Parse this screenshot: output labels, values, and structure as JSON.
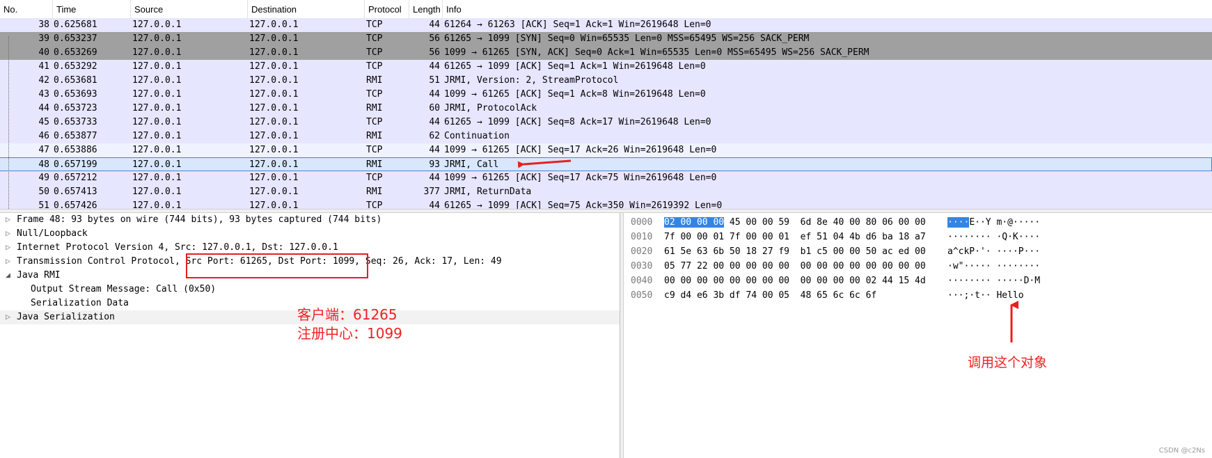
{
  "columns": [
    "No.",
    "Time",
    "Source",
    "Destination",
    "Protocol",
    "Length",
    "Info"
  ],
  "packets": [
    {
      "no": "38",
      "time": "0.625681",
      "src": "127.0.0.1",
      "dst": "127.0.0.1",
      "proto": "TCP",
      "len": "44",
      "info": "61264 → 61263 [ACK] Seq=1 Ack=1 Win=2619648 Len=0"
    },
    {
      "no": "39",
      "time": "0.653237",
      "src": "127.0.0.1",
      "dst": "127.0.0.1",
      "proto": "TCP",
      "len": "56",
      "info": "61265 → 1099 [SYN] Seq=0 Win=65535 Len=0 MSS=65495 WS=256 SACK_PERM"
    },
    {
      "no": "40",
      "time": "0.653269",
      "src": "127.0.0.1",
      "dst": "127.0.0.1",
      "proto": "TCP",
      "len": "56",
      "info": "1099 → 61265 [SYN, ACK] Seq=0 Ack=1 Win=65535 Len=0 MSS=65495 WS=256 SACK_PERM"
    },
    {
      "no": "41",
      "time": "0.653292",
      "src": "127.0.0.1",
      "dst": "127.0.0.1",
      "proto": "TCP",
      "len": "44",
      "info": "61265 → 1099 [ACK] Seq=1 Ack=1 Win=2619648 Len=0"
    },
    {
      "no": "42",
      "time": "0.653681",
      "src": "127.0.0.1",
      "dst": "127.0.0.1",
      "proto": "RMI",
      "len": "51",
      "info": "JRMI, Version: 2, StreamProtocol"
    },
    {
      "no": "43",
      "time": "0.653693",
      "src": "127.0.0.1",
      "dst": "127.0.0.1",
      "proto": "TCP",
      "len": "44",
      "info": "1099 → 61265 [ACK] Seq=1 Ack=8 Win=2619648 Len=0"
    },
    {
      "no": "44",
      "time": "0.653723",
      "src": "127.0.0.1",
      "dst": "127.0.0.1",
      "proto": "RMI",
      "len": "60",
      "info": "JRMI, ProtocolAck"
    },
    {
      "no": "45",
      "time": "0.653733",
      "src": "127.0.0.1",
      "dst": "127.0.0.1",
      "proto": "TCP",
      "len": "44",
      "info": "61265 → 1099 [ACK] Seq=8 Ack=17 Win=2619648 Len=0"
    },
    {
      "no": "46",
      "time": "0.653877",
      "src": "127.0.0.1",
      "dst": "127.0.0.1",
      "proto": "RMI",
      "len": "62",
      "info": "Continuation"
    },
    {
      "no": "47",
      "time": "0.653886",
      "src": "127.0.0.1",
      "dst": "127.0.0.1",
      "proto": "TCP",
      "len": "44",
      "info": "1099 → 61265 [ACK] Seq=17 Ack=26 Win=2619648 Len=0"
    },
    {
      "no": "48",
      "time": "0.657199",
      "src": "127.0.0.1",
      "dst": "127.0.0.1",
      "proto": "RMI",
      "len": "93",
      "info": "JRMI, Call"
    },
    {
      "no": "49",
      "time": "0.657212",
      "src": "127.0.0.1",
      "dst": "127.0.0.1",
      "proto": "TCP",
      "len": "44",
      "info": "1099 → 61265 [ACK] Seq=17 Ack=75 Win=2619648 Len=0"
    },
    {
      "no": "50",
      "time": "0.657413",
      "src": "127.0.0.1",
      "dst": "127.0.0.1",
      "proto": "RMI",
      "len": "377",
      "info": "JRMI, ReturnData"
    },
    {
      "no": "51",
      "time": "0.657426",
      "src": "127.0.0.1",
      "dst": "127.0.0.1",
      "proto": "TCP",
      "len": "44",
      "info": "61265 → 1099 [ACK] Seq=75 Ack=350 Win=2619392 Len=0"
    }
  ],
  "details": {
    "frame": "Frame 48: 93 bytes on wire (744 bits), 93 bytes captured (744 bits)",
    "null_loopback": "Null/Loopback",
    "ipv4": "Internet Protocol Version 4, Src: 127.0.0.1, Dst: 127.0.0.1",
    "tcp": "Transmission Control Protocol, Src Port: 61265, Dst Port: 1099, Seq: 26, Ack: 17, Len: 49",
    "java_rmi": "Java RMI",
    "output_stream": "Output Stream Message: Call (0x50)",
    "serialization_data": "Serialization Data",
    "java_serialization": "Java Serialization"
  },
  "bytes": [
    {
      "offset": "0000",
      "hex_hl": "02 00 00 00",
      "hex": " 45 00 00 59  6d 8e 40 00 80 06 00 00",
      "ascii_hl": "····",
      "ascii": "E··Y m·@·····"
    },
    {
      "offset": "0010",
      "hex_hl": "",
      "hex": "7f 00 00 01 7f 00 00 01  ef 51 04 4b d6 ba 18 a7",
      "ascii_hl": "",
      "ascii": "········ ·Q·K····"
    },
    {
      "offset": "0020",
      "hex_hl": "",
      "hex": "61 5e 63 6b 50 18 27 f9  b1 c5 00 00 50 ac ed 00",
      "ascii_hl": "",
      "ascii": "a^ckP·'· ····P···"
    },
    {
      "offset": "0030",
      "hex_hl": "",
      "hex": "05 77 22 00 00 00 00 00  00 00 00 00 00 00 00 00",
      "ascii_hl": "",
      "ascii": "·w\"····· ········"
    },
    {
      "offset": "0040",
      "hex_hl": "",
      "hex": "00 00 00 00 00 00 00 00  00 00 00 00 02 44 15 4d",
      "ascii_hl": "",
      "ascii": "········ ·····D·M"
    },
    {
      "offset": "0050",
      "hex_hl": "",
      "hex": "c9 d4 e6 3b df 74 00 05  48 65 6c 6c 6f",
      "ascii_hl": "",
      "ascii": "···;·t·· Hello"
    }
  ],
  "annotations": {
    "client": "客户端：61265",
    "registry": "注册中心：1099",
    "invoke_object": "调用这个对象"
  },
  "watermark": "CSDN @c2Ns",
  "colors": {
    "tcp_row": "#e7e6ff",
    "syn_row": "#a0a0a0",
    "selected_row": "#d8e7fb",
    "annotation_red": "#ee2222",
    "byte_highlight": "#3584e4"
  }
}
